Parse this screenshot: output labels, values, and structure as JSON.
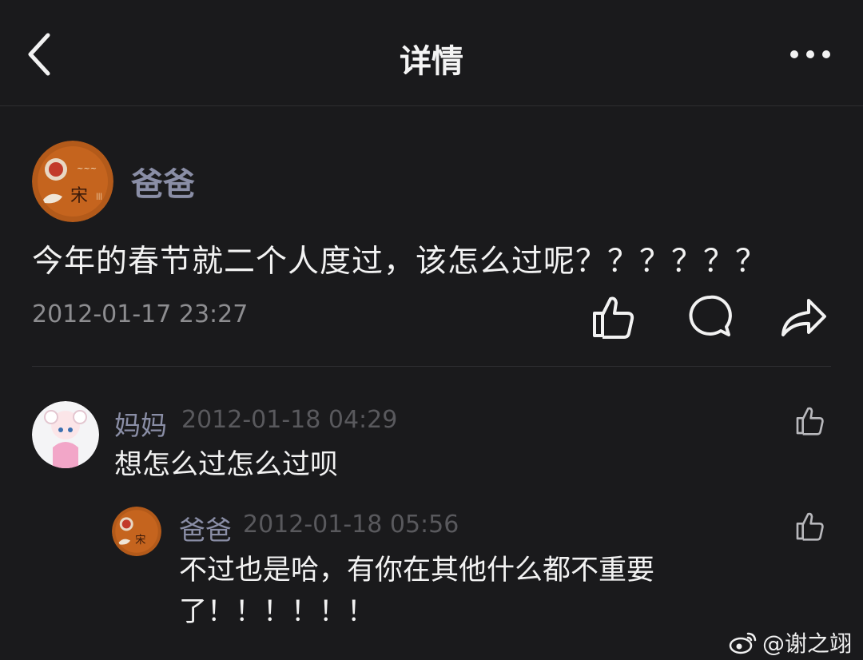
{
  "header": {
    "title": "详情"
  },
  "post": {
    "author": "爸爸",
    "avatar_text": "宋",
    "text": "今年的春节就二个人度过，该怎么过呢？？？？？？",
    "time": "2012-01-17 23:27"
  },
  "comments": [
    {
      "author": "妈妈",
      "time": "2012-01-18 04:29",
      "text": "想怎么过怎么过呗"
    }
  ],
  "reply": {
    "author": "爸爸",
    "avatar_text": "宋",
    "time": "2012-01-18 05:56",
    "text": "不过也是哈，有你在其他什么都不重要了！！！！！！"
  },
  "watermark": {
    "text": "@谢之翊"
  },
  "icons": {
    "back": "chevron-left-icon",
    "more": "more-horizontal-icon",
    "like": "thumbs-up-icon",
    "comment": "comment-bubble-icon",
    "share": "share-arrow-icon",
    "watermark_logo": "weibo-logo-icon"
  },
  "colors": {
    "background": "#1a1a1c",
    "username": "#8a8ea6",
    "timestamp": "#8d8d90",
    "text": "#f2f2f2"
  }
}
